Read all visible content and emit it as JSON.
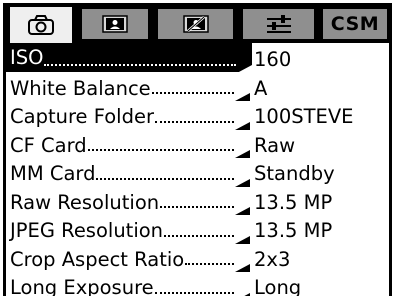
{
  "tabs": [
    {
      "icon": "camera-icon",
      "active": true
    },
    {
      "icon": "playback-icon",
      "active": false
    },
    {
      "icon": "no-photo-icon",
      "active": false
    },
    {
      "icon": "settings-sliders-icon",
      "active": false
    },
    {
      "label": "CSM",
      "active": false
    }
  ],
  "menu": {
    "items": [
      {
        "label": "ISO",
        "value": "160",
        "selected": true
      },
      {
        "label": "White Balance",
        "value": "A",
        "selected": false
      },
      {
        "label": "Capture Folder",
        "value": "100STEVE",
        "selected": false
      },
      {
        "label": "CF Card",
        "value": "Raw",
        "selected": false
      },
      {
        "label": "MM Card",
        "value": "Standby",
        "selected": false
      },
      {
        "label": "Raw Resolution",
        "value": "13.5 MP",
        "selected": false
      },
      {
        "label": "JPEG Resolution",
        "value": "13.5 MP",
        "selected": false
      },
      {
        "label": "Crop Aspect Ratio",
        "value": "2x3",
        "selected": false
      },
      {
        "label": "Long Exposure",
        "value": "Long",
        "selected": false
      }
    ]
  },
  "colors": {
    "frame": "#000000",
    "active_tab": "#efefef",
    "inactive_tab": "#8f8f8f",
    "selected_row": "#000000",
    "selected_text": "#ffffff"
  }
}
